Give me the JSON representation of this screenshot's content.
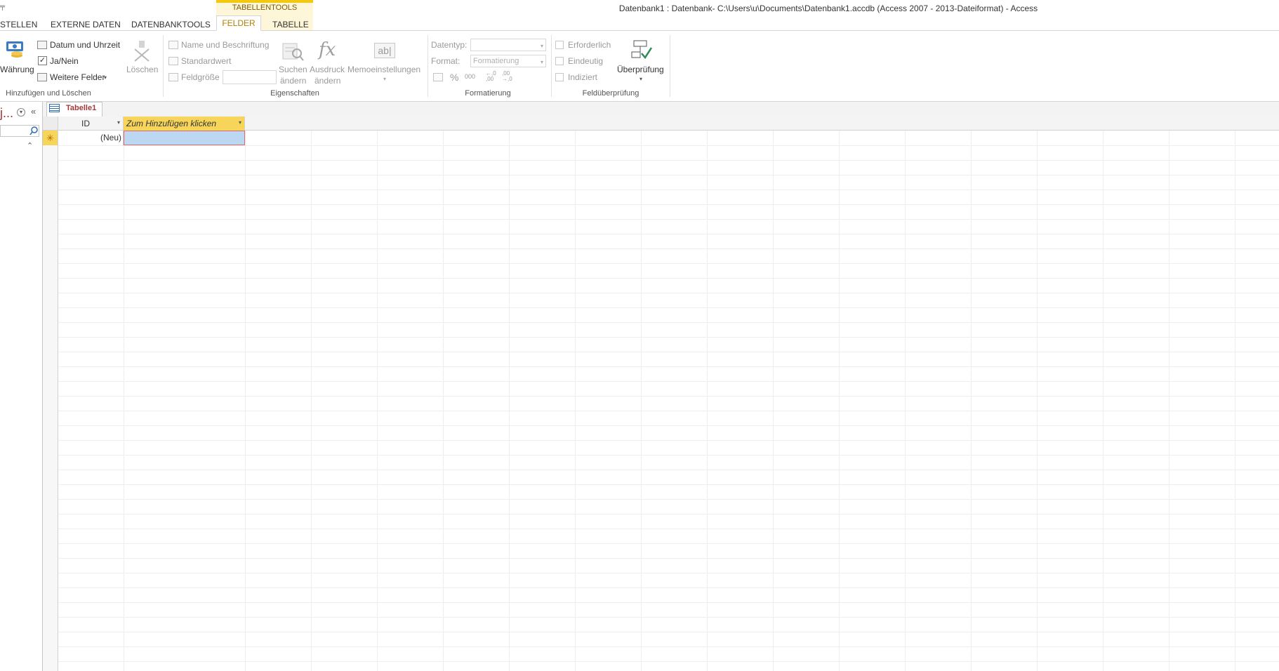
{
  "window": {
    "title": "Datenbank1 : Datenbank- C:\\Users\\u\\Documents\\Datenbank1.accdb (Access 2007 - 2013-Dateiformat) - Access"
  },
  "ribbon_tabs": {
    "context_group": "TABELLENTOOLS",
    "tabs": [
      "STELLEN",
      "EXTERNE DATEN",
      "DATENBANKTOOLS",
      "FELDER",
      "TABELLE"
    ],
    "active": "FELDER"
  },
  "ribbon": {
    "hinzufuegen": {
      "group_label": "Hinzufügen und Löschen",
      "waehrung": "Währung",
      "datum": "Datum und Uhrzeit",
      "janein": "Ja/Nein",
      "weitere": "Weitere Felder",
      "loeschen": "Löschen"
    },
    "eigenschaften": {
      "group_label": "Eigenschaften",
      "name": "Name und Beschriftung",
      "standardwert": "Standardwert",
      "feldgroesse": "Feldgröße",
      "suchen_1": "Suchen",
      "suchen_2": "ändern",
      "ausdruck_1": "Ausdruck",
      "ausdruck_2": "ändern",
      "memo": "Memoeinstellungen"
    },
    "formatierung": {
      "group_label": "Formatierung",
      "datentyp": "Datentyp:",
      "format": "Format:",
      "format_value": "Formatierung",
      "percent": "%",
      "thousands": "000",
      "inc_decimal": "←,0 ,00",
      "dec_decimal": ",00 →,0"
    },
    "feldueberpruefung": {
      "group_label": "Feldüberprüfung",
      "erforderlich": "Erforderlich",
      "eindeutig": "Eindeutig",
      "indiziert": "Indiziert",
      "ueberpruefung": "Überprüfung"
    }
  },
  "nav_pane": {
    "title_fragment": "j..."
  },
  "document": {
    "tab_label": "Tabelle1"
  },
  "table": {
    "columns": [
      "ID",
      "Zum Hinzufügen klicken"
    ],
    "new_row_marker": "✳",
    "new_row_id": "(Neu)"
  },
  "colors": {
    "accent_yellow": "#f2c811",
    "access_red": "#a4373a",
    "selection_blue": "#bcd7f1"
  }
}
